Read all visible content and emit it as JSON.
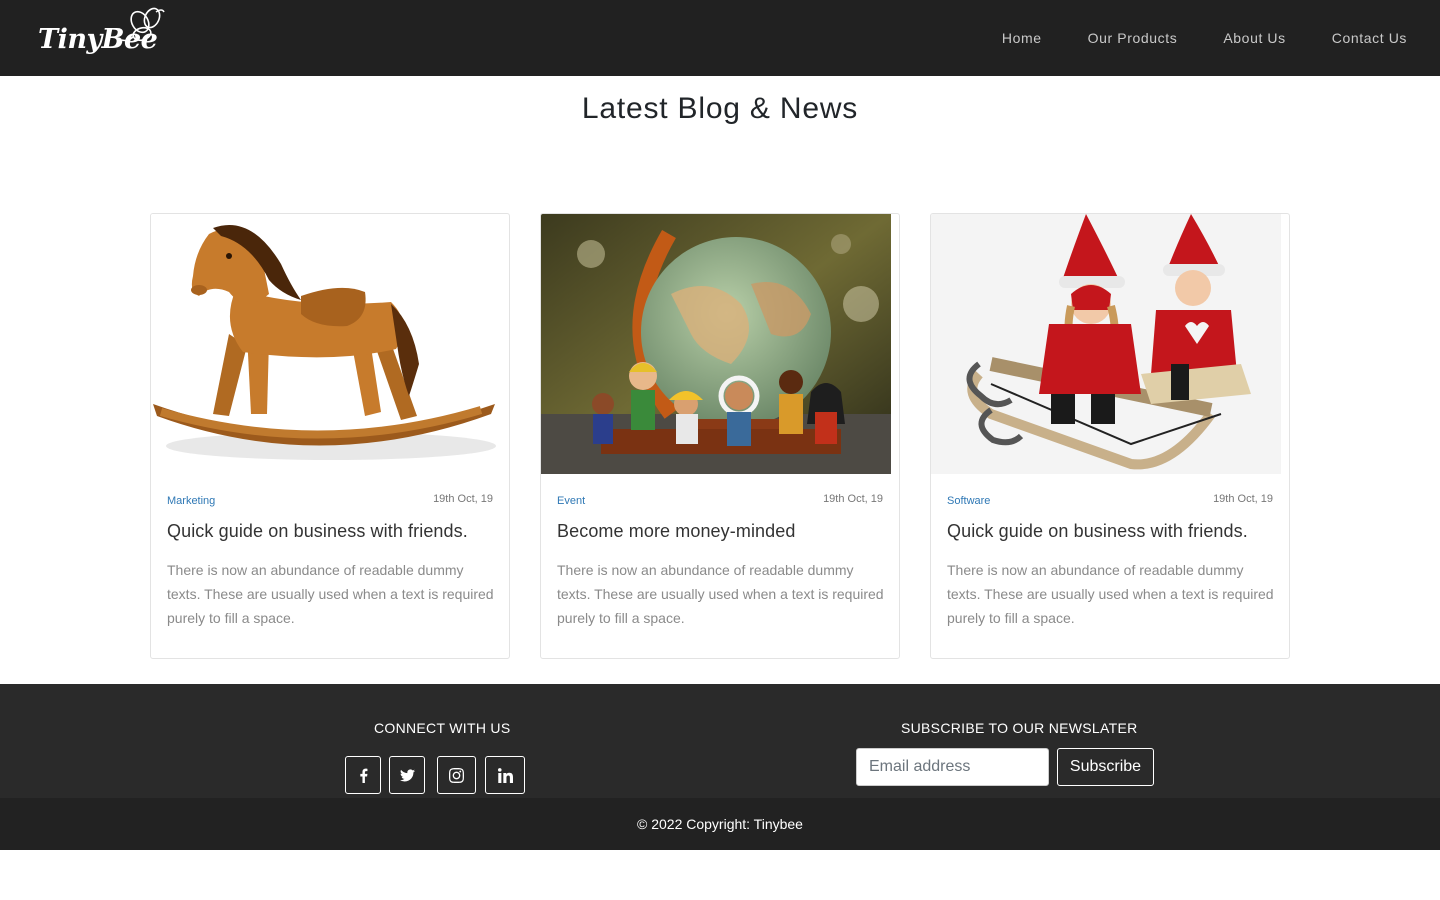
{
  "navbar": {
    "brand": "TinyBee",
    "links": [
      "Home",
      "Our Products",
      "About Us",
      "Contact Us"
    ]
  },
  "section": {
    "title": "Latest Blog & News"
  },
  "cards": [
    {
      "image": "rocking-horse",
      "category": "Marketing",
      "date": "19th Oct, 19",
      "title": "Quick guide on business with friends.",
      "text": "There is now an abundance of readable dummy texts. These are usually used when a text is required purely to fill a space."
    },
    {
      "image": "globe-dolls",
      "category": "Event",
      "date": "19th Oct, 19",
      "title": "Become more money-minded",
      "text": "There is now an abundance of readable dummy texts. These are usually used when a text is required purely to fill a space."
    },
    {
      "image": "sled-dolls",
      "category": "Software",
      "date": "19th Oct, 19",
      "title": "Quick guide on business with friends.",
      "text": "There is now an abundance of readable dummy texts. These are usually used when a text is required purely to fill a space."
    }
  ],
  "footer": {
    "connect_title": "CONNECT WITH US",
    "social_icons": [
      "facebook-icon",
      "twitter-icon",
      "instagram-icon",
      "linkedin-icon"
    ],
    "newsletter_title": "SUBSCRIBE TO OUR NEWSLATER",
    "email_placeholder": "Email address",
    "subscribe_label": "Subscribe",
    "copyright": "© 2022 Copyright: Tinybee"
  },
  "colors": {
    "navbar_bg": "#212121",
    "footer_bg": "#2a2a2a",
    "copyright_bg": "#222222",
    "category_link": "#2f78b5"
  }
}
